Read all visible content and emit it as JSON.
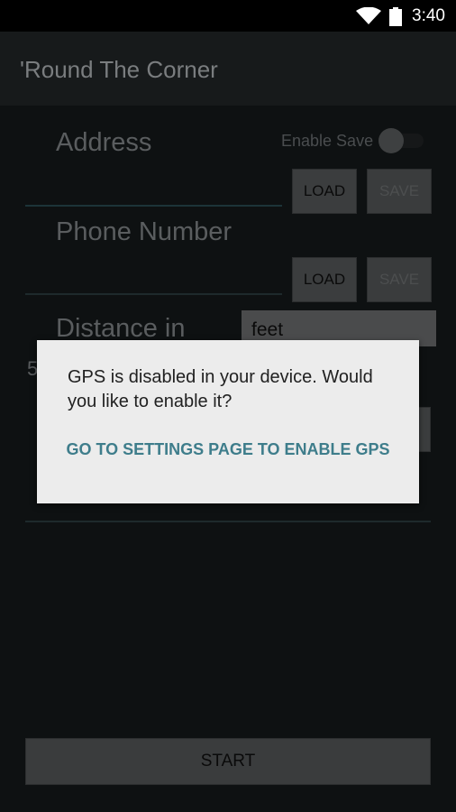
{
  "status_bar": {
    "time": "3:40",
    "icons": [
      "wifi-icon",
      "battery-icon"
    ]
  },
  "app_bar": {
    "title": "'Round The Corner"
  },
  "form": {
    "address_label": "Address",
    "enable_save_label": "Enable Save",
    "phone_label": "Phone Number",
    "distance_label": "Distance in",
    "distance_unit": "feet",
    "partial_value": "5",
    "load_label": "LOAD",
    "save_label": "SAVE"
  },
  "start_label": "START",
  "dialog": {
    "message": "GPS is disabled in your device. Would you like to enable it?",
    "action": "GO TO SETTINGS PAGE TO ENABLE GPS"
  },
  "colors": {
    "dialog_bg": "#ececec",
    "accent": "#3e7d8b",
    "dim_background": "#0e1112"
  }
}
